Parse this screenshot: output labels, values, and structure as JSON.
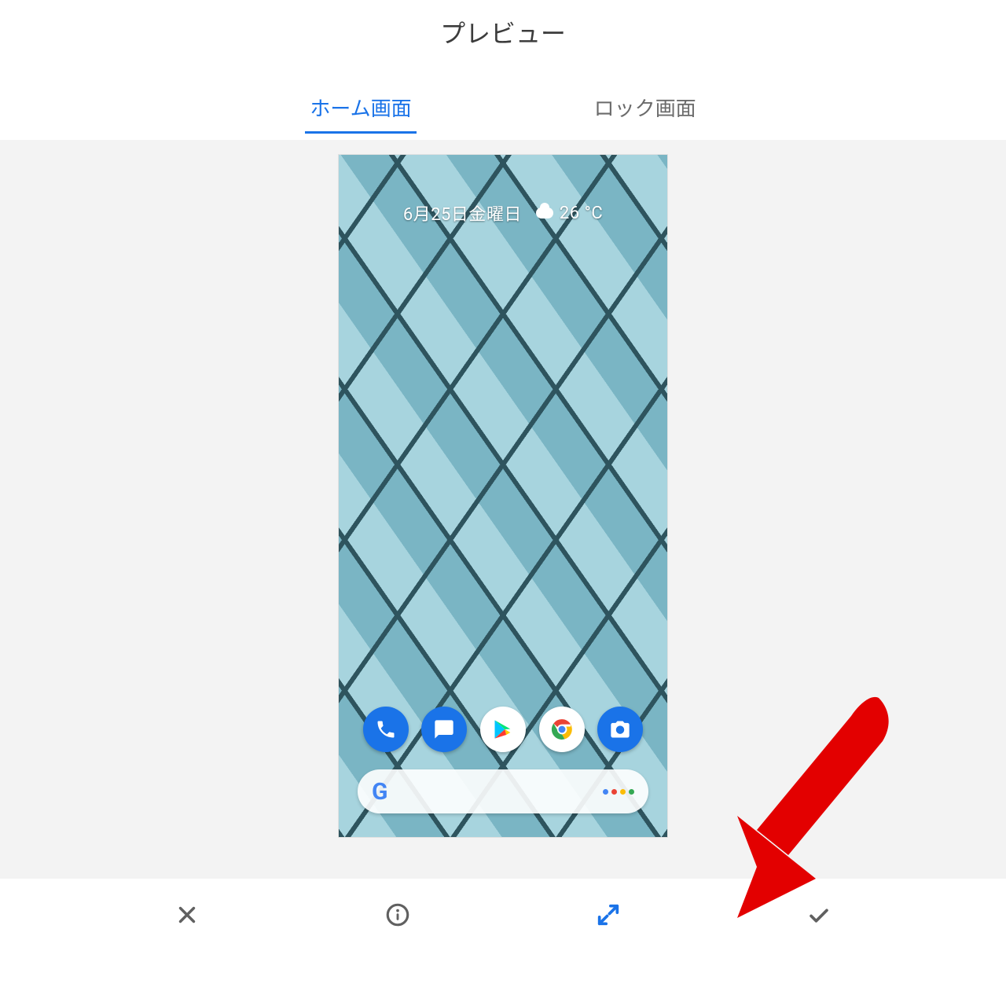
{
  "header": {
    "title": "プレビュー"
  },
  "tabs": {
    "home": {
      "label": "ホーム画面",
      "active": true
    },
    "lock": {
      "label": "ロック画面",
      "active": false
    }
  },
  "home_preview": {
    "date_label": "6月25日金曜日",
    "temperature_label": "26 °C",
    "dock_apps": [
      "phone",
      "messages",
      "play-store",
      "chrome",
      "camera"
    ]
  },
  "actions": {
    "close": "close-icon",
    "info": "info-icon",
    "fullscreen": "fullscreen-icon",
    "confirm": "check-icon"
  },
  "annotation": {
    "type": "arrow",
    "points_to": "confirm-button",
    "color": "#E30000"
  }
}
